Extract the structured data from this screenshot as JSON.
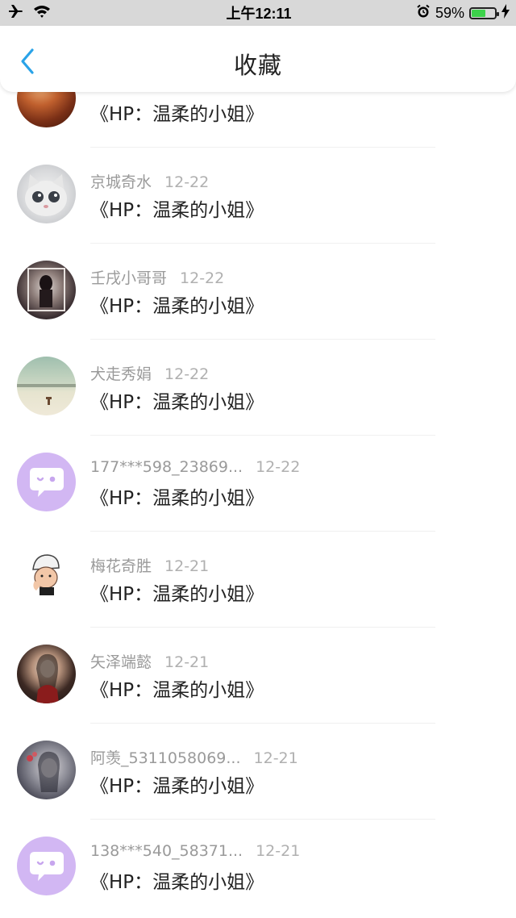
{
  "status_bar": {
    "time": "上午12:11",
    "battery_percent": "59%",
    "battery_level": 0.59,
    "icons": [
      "airplane-icon",
      "wifi-icon",
      "alarm-icon",
      "battery-icon",
      "charging-icon"
    ]
  },
  "nav": {
    "title": "收藏",
    "back_icon": "chevron-left-icon",
    "accent_color": "#2aa3e8"
  },
  "list": {
    "items": [
      {
        "name": "",
        "date": "",
        "title": "《HP：温柔的小姐》",
        "avatar": "food"
      },
      {
        "name": "京城奇水",
        "date": "12-22",
        "title": "《HP：温柔的小姐》",
        "avatar": "cat"
      },
      {
        "name": "壬戌小哥哥",
        "date": "12-22",
        "title": "《HP：温柔的小姐》",
        "avatar": "girl-dark"
      },
      {
        "name": "犬走秀娟",
        "date": "12-22",
        "title": "《HP：温柔的小姐》",
        "avatar": "field"
      },
      {
        "name": "177***598_23869...",
        "date": "12-22",
        "title": "《HP：温柔的小姐》",
        "avatar": "default"
      },
      {
        "name": "梅花奇胜",
        "date": "12-21",
        "title": "《HP：温柔的小姐》",
        "avatar": "cartoon"
      },
      {
        "name": "矢泽端懿",
        "date": "12-21",
        "title": "《HP：温柔的小姐》",
        "avatar": "girl-portrait"
      },
      {
        "name": "阿羡_5311058069...",
        "date": "12-21",
        "title": "《HP：温柔的小姐》",
        "avatar": "girl-gray"
      },
      {
        "name": "138***540_58371...",
        "date": "12-21",
        "title": "《HP：温柔的小姐》",
        "avatar": "default"
      }
    ]
  }
}
